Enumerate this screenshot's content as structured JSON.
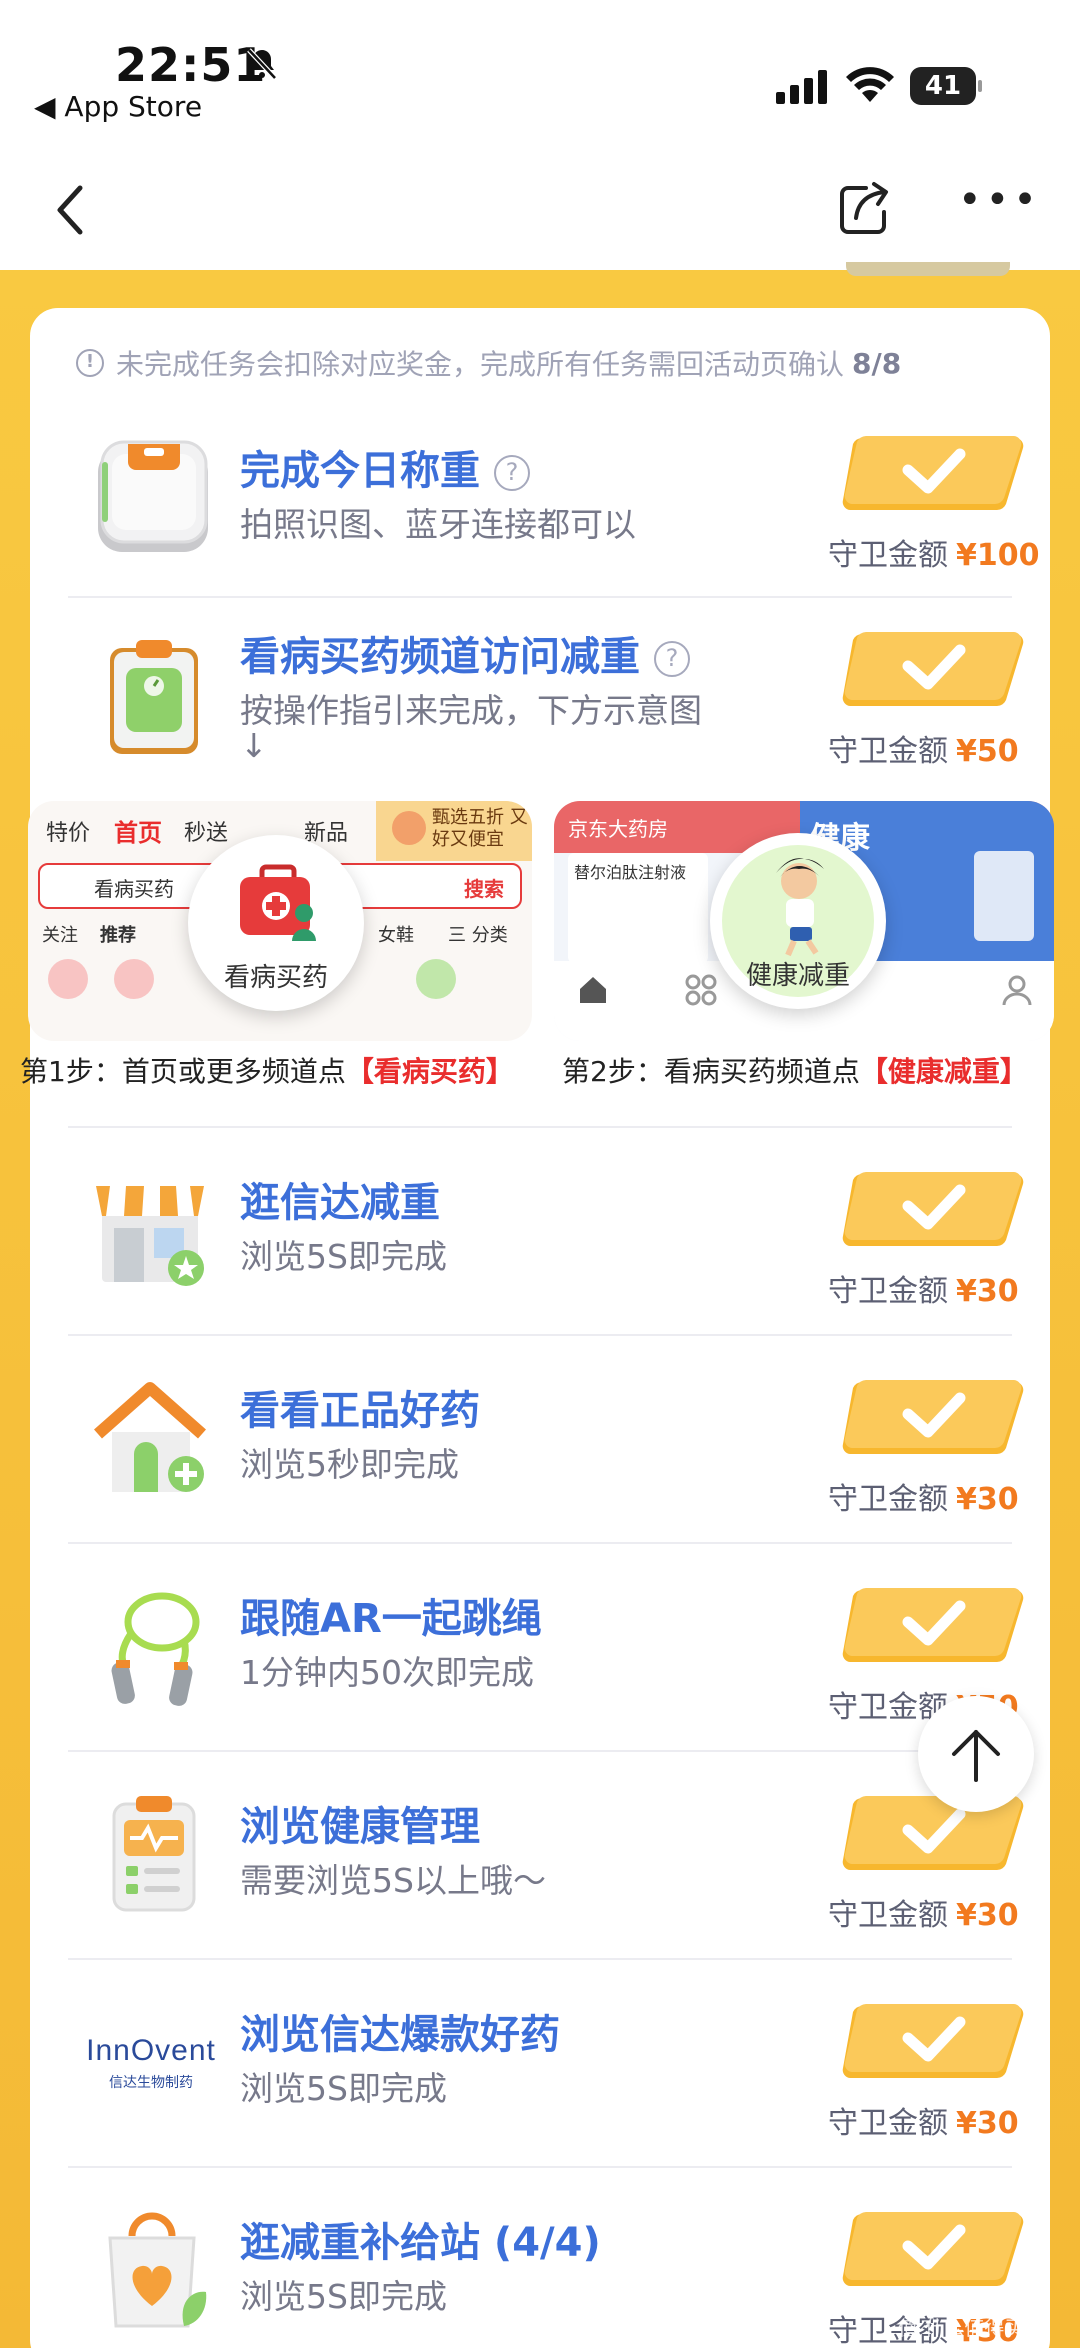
{
  "status": {
    "time": "22:51",
    "back_app": "◀ App Store",
    "battery": "41"
  },
  "notice": {
    "text": "未完成任务会扣除对应奖金，完成所有任务需回活动页确认",
    "count": "8/8"
  },
  "reward_label": "守卫金额",
  "tasks": [
    {
      "title": "完成今日称重",
      "desc": "拍照识图、蓝牙连接都可以",
      "amount": "¥100",
      "icon": "scale-icon",
      "has_help": true
    },
    {
      "title": "看病买药频道访问减重",
      "desc": "按操作指引来完成，下方示意图",
      "desc2": "↓",
      "amount": "¥50",
      "icon": "clipboard-scale-icon",
      "has_help": true
    },
    {
      "title": "逛信达减重",
      "desc": "浏览5S即完成",
      "amount": "¥30",
      "icon": "store-icon"
    },
    {
      "title": "看看正品好药",
      "desc": "浏览5秒即完成",
      "amount": "¥30",
      "icon": "house-plus-icon"
    },
    {
      "title": "跟随AR一起跳绳",
      "desc": "1分钟内50次即完成",
      "amount": "¥50",
      "icon": "jump-rope-icon"
    },
    {
      "title": "浏览健康管理",
      "desc": "需要浏览5S以上哦～",
      "amount": "¥30",
      "icon": "health-report-icon"
    },
    {
      "title": "浏览信达爆款好药",
      "desc": "浏览5S即完成",
      "amount": "¥30",
      "icon": "innovent-logo"
    },
    {
      "title": "逛减重补给站 (4/4)",
      "desc": "浏览5S即完成",
      "amount": "¥30",
      "icon": "heart-bag-icon"
    }
  ],
  "steps": [
    {
      "caption_prefix": "第1步：首页或更多频道点",
      "caption_highlight": "【看病买药】",
      "button_label": "看病买药",
      "tabs": [
        "特价",
        "首页",
        "秒送",
        "新品"
      ],
      "search_text": "看病买药",
      "search_btn": "搜索",
      "promo": "甄选五折 又好又便宜",
      "subtabs": [
        "关注",
        "推荐"
      ],
      "right_items": [
        "女鞋",
        "三 分类"
      ]
    },
    {
      "caption_prefix": "第2步：看病买药频道点",
      "caption_highlight": "【健康减重】",
      "button_label": "健康减重",
      "header": "京东大药房",
      "product": "替尔泊肽注射液",
      "banner": "健康"
    }
  ],
  "watermark": "值 什么值得买"
}
